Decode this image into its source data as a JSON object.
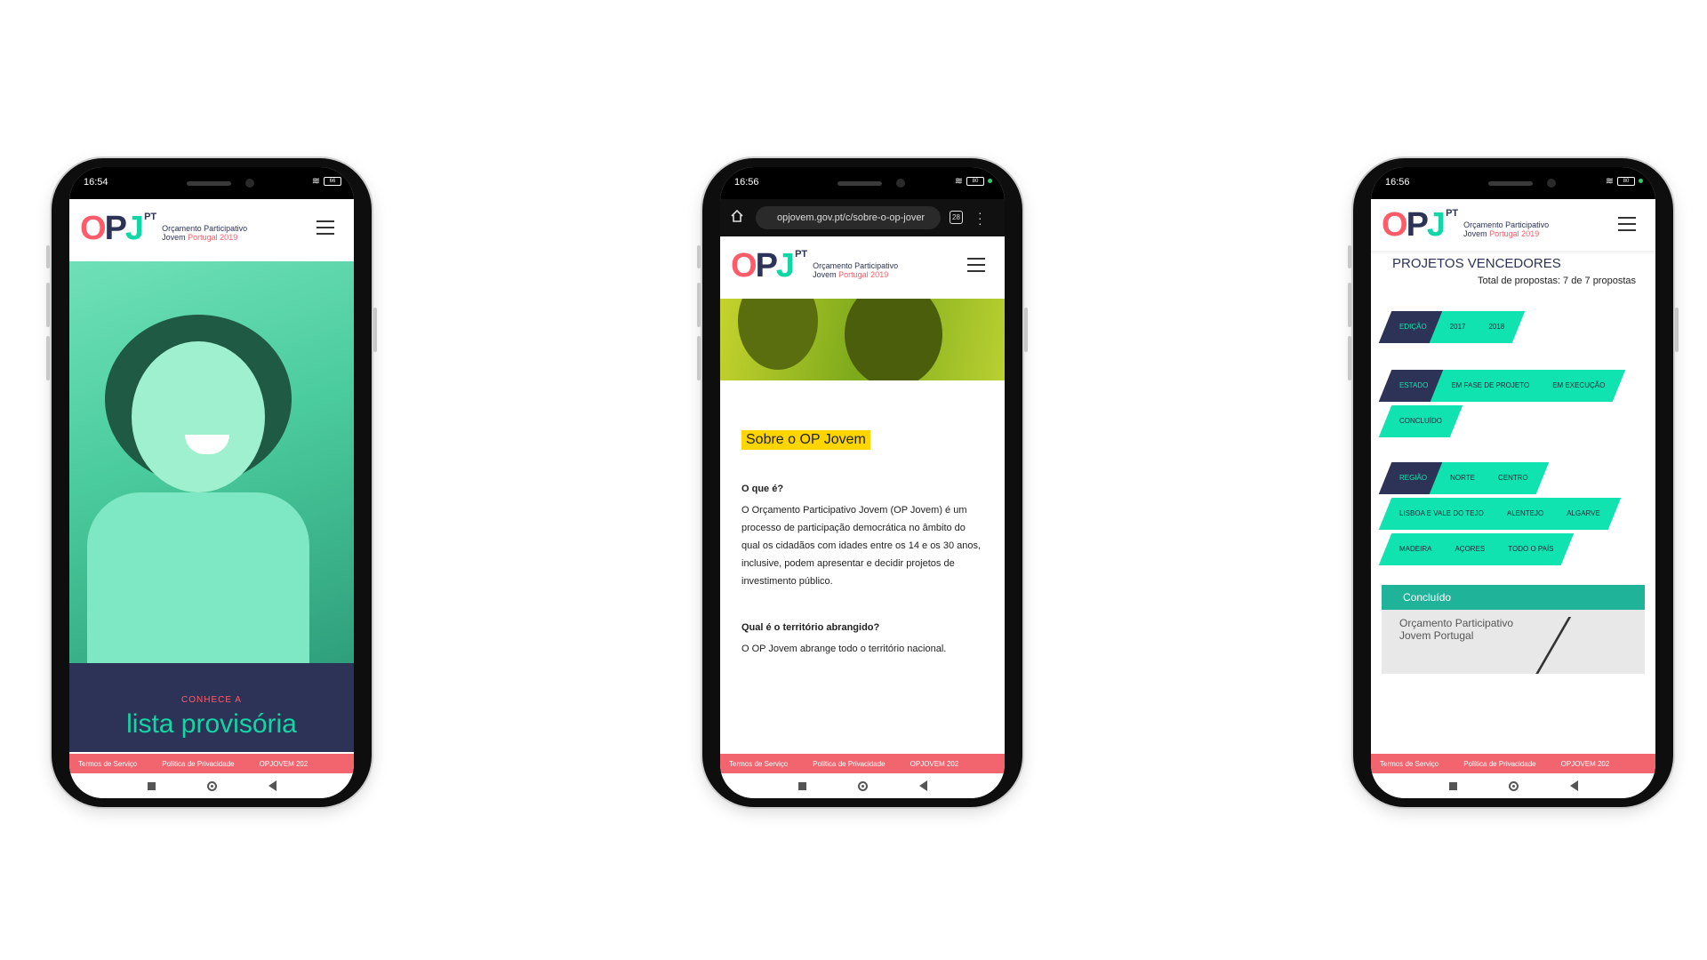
{
  "colors": {
    "pink": "#ff5c6a",
    "navy": "#2d3356",
    "mint": "#11d6a5",
    "yellow": "#ffd500",
    "footer": "#f2646e"
  },
  "phones": [
    {
      "status": {
        "time": "16:54",
        "battery": "66"
      },
      "logo": {
        "letters_o": "O",
        "letters_p": "P",
        "letters_j": "J",
        "pt": "PT",
        "line1": "Orçamento Participativo",
        "line2_a": "Jovem",
        "line2_b": "Portugal 2019"
      },
      "hero": {
        "kicker": "CONHECE A",
        "title": "lista provisória"
      },
      "footer": [
        "Termos de Serviço",
        "Política de Privacidade",
        "OPJOVEM 202"
      ]
    },
    {
      "status": {
        "time": "16:56",
        "battery": "80"
      },
      "browser": {
        "url": "opjovem.gov.pt/c/sobre-o-op-jover",
        "tabs": "28"
      },
      "logo": {
        "letters_o": "O",
        "letters_p": "P",
        "letters_j": "J",
        "pt": "PT",
        "line1": "Orçamento Participativo",
        "line2_a": "Jovem",
        "line2_b": "Portugal 2019"
      },
      "content": {
        "title": "Sobre o OP Jovem",
        "q1": "O que é?",
        "p1": "O Orçamento Participativo Jovem (OP Jovem) é um processo de participação democrática no âmbito do qual os cidadãos com idades entre os 14 e os 30 anos, inclusive, podem apresentar e decidir projetos de investimento público.",
        "q2": "Qual é o território abrangido?",
        "p2": "O OP Jovem abrange todo o território nacional."
      },
      "footer": [
        "Termos de Serviço",
        "Política de Privacidade",
        "OPJOVEM 202"
      ]
    },
    {
      "status": {
        "time": "16:56",
        "battery": "80"
      },
      "logo": {
        "letters_o": "O",
        "letters_p": "P",
        "letters_j": "J",
        "pt": "PT",
        "line1": "Orçamento Participativo",
        "line2_a": "Jovem",
        "line2_b": "Portugal 2019"
      },
      "content": {
        "title": "PROJETOS VENCEDORES",
        "total": "Total de propostas: 7 de 7 propostas",
        "edicao": [
          "EDIÇÃO",
          "2017",
          "2018"
        ],
        "estado": [
          "ESTADO",
          "EM FASE DE PROJETO",
          "EM EXECUÇÃO",
          "CONCLUÍDO"
        ],
        "regiao": [
          "REGIÃO",
          "NORTE",
          "CENTRO",
          "LISBOA E VALE DO TEJO",
          "ALENTEJO",
          "ALGARVE",
          "MADEIRA",
          "AÇORES",
          "TODO O PAÍS"
        ],
        "card_status": "Concluído",
        "card_logo_1": "Orçamento Participativo",
        "card_logo_2": "Jovem Portugal"
      },
      "footer": [
        "Termos de Serviço",
        "Política de Privacidade",
        "OPJOVEM 202"
      ]
    }
  ]
}
